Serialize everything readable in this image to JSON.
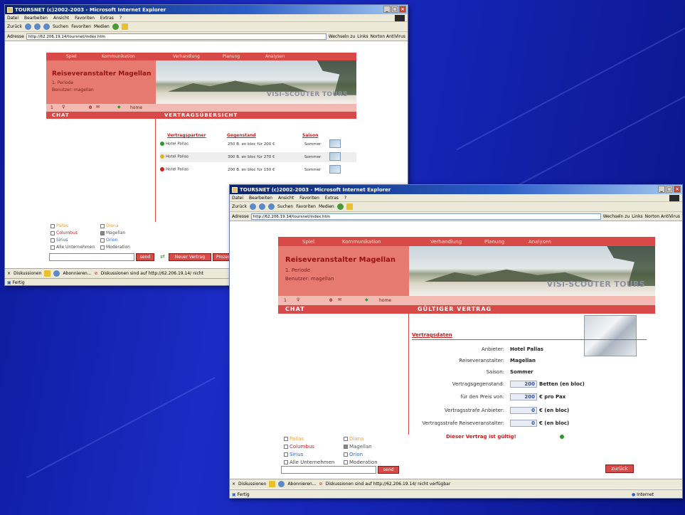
{
  "window1": {
    "title": "TOURSNET (c)2002-2003 - Microsoft Internet Explorer",
    "menu": [
      "Datei",
      "Bearbeiten",
      "Ansicht",
      "Favoriten",
      "Extras",
      "?"
    ],
    "toolbar": {
      "back": "Zurück",
      "search": "Suchen",
      "favorites": "Favoriten",
      "media": "Medien"
    },
    "address_label": "Adresse",
    "url": "http://62.206.19.14/toursnet/index.htm",
    "go": "Wechseln zu",
    "links": "Links",
    "norton": "Norton AntiVirus",
    "nav": [
      "Spiel",
      "Kommunikation",
      "Verhandlung",
      "Planung",
      "Analysen"
    ],
    "company": "Reiseveranstalter Magellan",
    "period": "1. Periode",
    "user": "Benutzer: magellan",
    "status": {
      "num1": "1",
      "num2": "0",
      "home": "home"
    },
    "logo": "VISI-SCOUTER TOURS",
    "left_section": "CHAT",
    "right_section": "VERTRAGSÜBERSICHT",
    "table": {
      "headers": [
        "Vertragspartner",
        "Gegenstand",
        "Saison"
      ],
      "rows": [
        {
          "partner": "Hotel Pallas",
          "item": "250 B. en bloc für 200 €",
          "season": "Sommer",
          "status": "green"
        },
        {
          "partner": "Hotel Pallas",
          "item": "300 B. en bloc für 270 €",
          "season": "Sommer",
          "status": "yellow"
        },
        {
          "partner": "Hotel Pallas",
          "item": "200 B. en bloc für 150 €",
          "season": "Sommer",
          "status": "red"
        }
      ]
    },
    "checks": [
      "Pallas",
      "Diana",
      "Columbus",
      "Magellan",
      "Sirius",
      "Orion",
      "Alle Unternehmen",
      "Moderation"
    ],
    "send": "send",
    "new_contract": "Neuer Vertrag",
    "more_btn": "Prozessen",
    "discussions": "Diskussionen",
    "subscribe": "Abonnieren...",
    "disc_msg": "Diskussionen sind auf http://62.206.19.14/ nicht",
    "status_text": "Fertig"
  },
  "window2": {
    "title": "TOURSNET (c)2002-2003 - Microsoft Internet Explorer",
    "menu": [
      "Datei",
      "Bearbeiten",
      "Ansicht",
      "Favoriten",
      "Extras",
      "?"
    ],
    "toolbar": {
      "back": "Zurück",
      "search": "Suchen",
      "favorites": "Favoriten",
      "media": "Medien"
    },
    "address_label": "Adresse",
    "url": "http://62.206.19.14/toursnet/index.htm",
    "go": "Wechseln zu",
    "links": "Links",
    "norton": "Norton AntiVirus",
    "nav": [
      "Spiel",
      "Kommunikation",
      "Verhandlung",
      "Planung",
      "Analysen"
    ],
    "company": "Reiseveranstalter Magellan",
    "period": "1. Periode",
    "user": "Benutzer: magellan",
    "status": {
      "num1": "1",
      "num2": "0",
      "home": "home"
    },
    "logo": "VISI-SCOUTER TOURS",
    "left_section": "CHAT",
    "right_section": "GÜLTIGER VERTRAG",
    "form_header": "Vertragsdaten",
    "fields": {
      "anbieter_label": "Anbieter:",
      "anbieter": "Hotel Pallas",
      "rv_label": "Reiseveranstalter:",
      "rv": "Magellan",
      "saison_label": "Saison:",
      "saison": "Sommer",
      "gegenstand_label": "Vertragsgegenstand:",
      "gegenstand": "200",
      "gegenstand_unit": "Betten (en bloc)",
      "preis_label": "für den Preis von:",
      "preis": "200",
      "preis_unit": "€ pro Pax",
      "strafe_a_label": "Vertragsstrafe Anbieter:",
      "strafe_a": "0",
      "strafe_a_unit": "€ (en bloc)",
      "strafe_r_label": "Vertragsstrafe Reiseveranstalter:",
      "strafe_r": "0",
      "strafe_r_unit": "€ (en bloc)"
    },
    "valid_msg": "Dieser Vertrag ist gültig!",
    "back_btn": "zurück",
    "checks": [
      "Pallas",
      "Diana",
      "Columbus",
      "Magellan",
      "Sirius",
      "Orion",
      "Alle Unternehmen",
      "Moderation"
    ],
    "send": "send",
    "discussions": "Diskussionen",
    "subscribe": "Abonnieren...",
    "disc_msg": "Diskussionen sind auf http://62.206.19.14/ nicht verfügbar",
    "status_text": "Fertig",
    "zone": "Internet"
  }
}
